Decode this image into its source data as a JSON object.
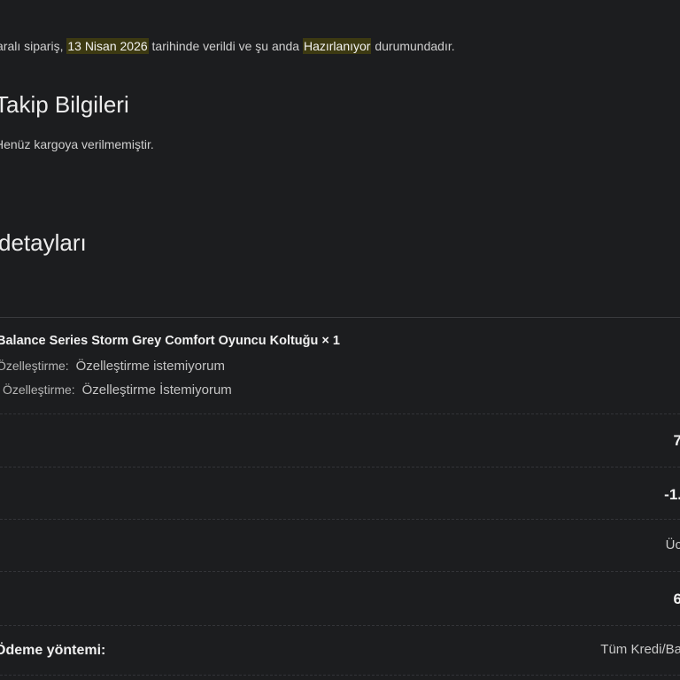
{
  "order_status": {
    "prefix": "aralı sipariş, ",
    "date": "13 Nisan 2026",
    "middle": " tarihinde verildi ve şu anda ",
    "status": "Hazırlanıyor",
    "suffix": " durumundadır."
  },
  "tracking": {
    "title": "Takip Bilgileri",
    "text": "Henüz kargoya verilmemiştir."
  },
  "details": {
    "title": "detayları"
  },
  "product": {
    "name": "Balance Series Storm Grey Comfort Oyuncu Koltuğu × 1",
    "options": [
      {
        "key": "Özelleştirme:",
        "value": "Özelleştirme istemiyorum"
      },
      {
        "key": "Özelleştirme:",
        "value": "Özelleştirme İstemiyorum"
      }
    ]
  },
  "summary_rows": [
    {
      "label": "",
      "value": "7"
    },
    {
      "label": "",
      "value": "-1."
    },
    {
      "label": "",
      "value": "Üc"
    },
    {
      "label": "",
      "value": "6"
    },
    {
      "label": "Ödeme yöntemi:",
      "value": "Tüm Kredi/Ba"
    }
  ]
}
